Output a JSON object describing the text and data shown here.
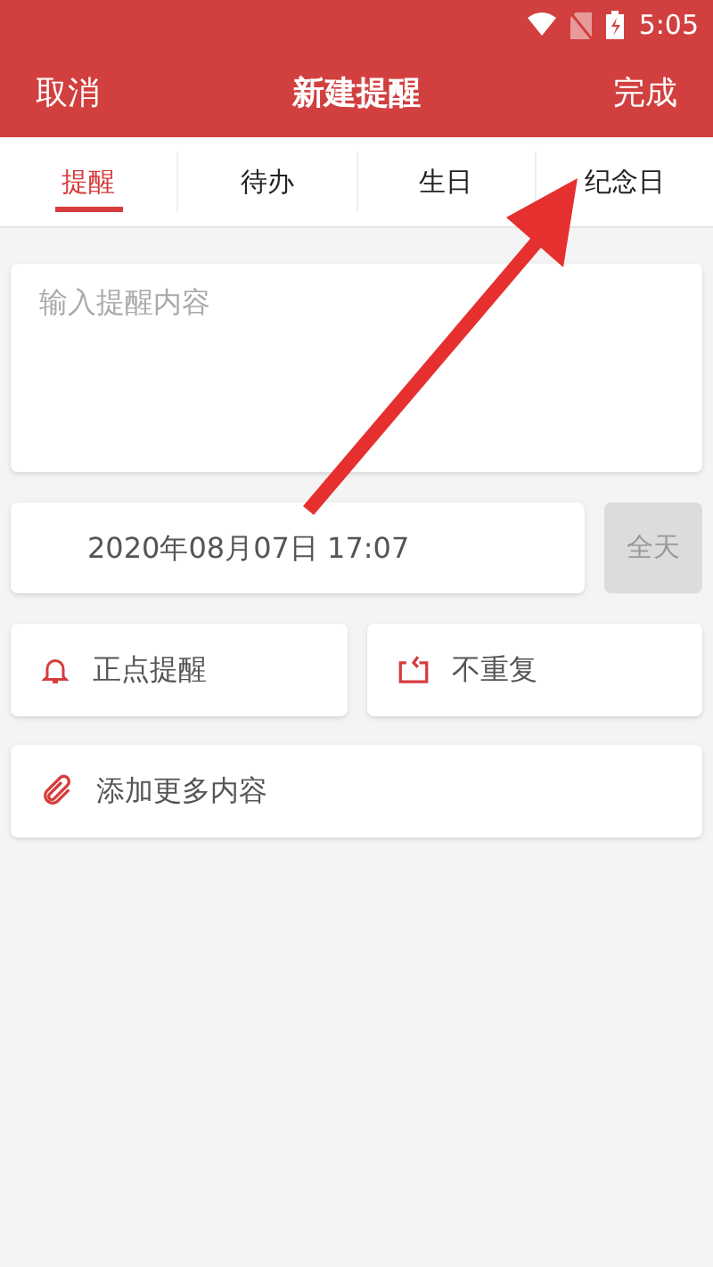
{
  "status_bar": {
    "time": "5:05"
  },
  "header": {
    "cancel": "取消",
    "title": "新建提醒",
    "done": "完成"
  },
  "tabs": [
    {
      "label": "提醒",
      "selected": true
    },
    {
      "label": "待办",
      "selected": false
    },
    {
      "label": "生日",
      "selected": false
    },
    {
      "label": "纪念日",
      "selected": false
    }
  ],
  "content": {
    "placeholder": "输入提醒内容"
  },
  "date": {
    "value": "2020年08月07日 17:07",
    "all_day": "全天"
  },
  "options": [
    {
      "kind": "bell",
      "label": "正点提醒"
    },
    {
      "kind": "repeat",
      "label": "不重复"
    }
  ],
  "add_more": "添加更多内容"
}
